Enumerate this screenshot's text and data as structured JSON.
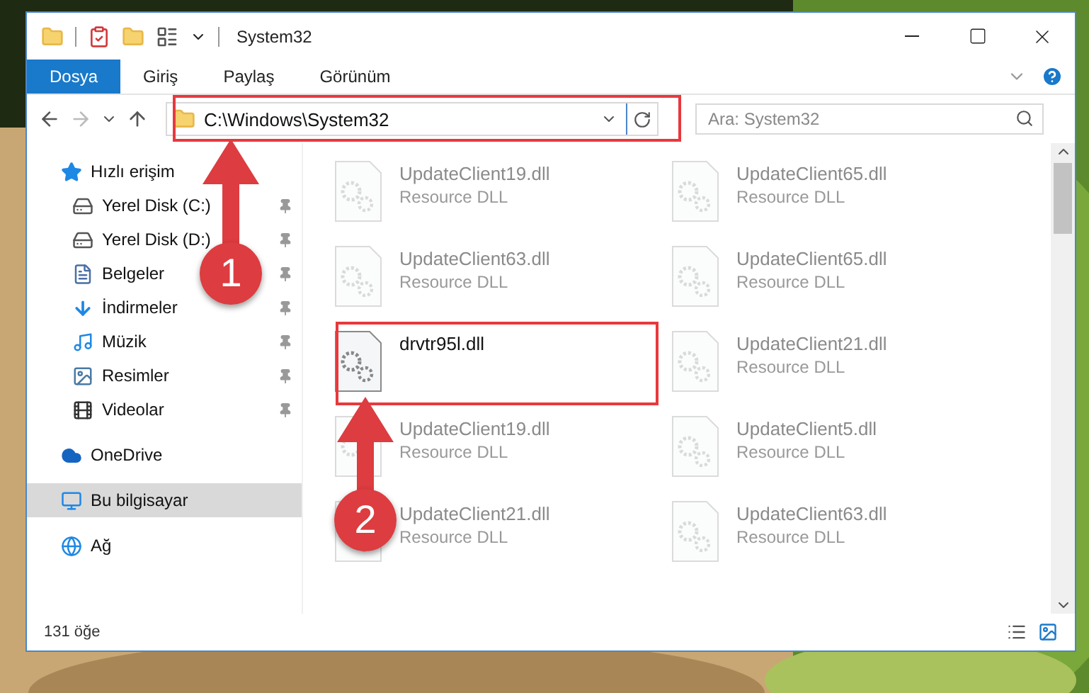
{
  "window": {
    "title": "System32"
  },
  "ribbon": {
    "tabs": [
      {
        "label": "Dosya",
        "selected": true
      },
      {
        "label": "Giriş",
        "selected": false
      },
      {
        "label": "Paylaş",
        "selected": false
      },
      {
        "label": "Görünüm",
        "selected": false
      }
    ]
  },
  "address": {
    "path": "C:\\Windows\\System32"
  },
  "search": {
    "placeholder": "Ara: System32"
  },
  "sidebar": {
    "items": [
      {
        "label": "Hızlı erişim",
        "kind": "quick-access",
        "selected": false,
        "children": [
          {
            "label": "Yerel Disk (C:)",
            "kind": "system-drive",
            "selected": false,
            "pinned": true
          },
          {
            "label": "Yerel Disk (D:)",
            "kind": "drive",
            "selected": false,
            "pinned": true
          },
          {
            "label": "Belgeler",
            "kind": "documents",
            "selected": false,
            "pinned": true
          },
          {
            "label": "İndirmeler",
            "kind": "downloads",
            "selected": false,
            "pinned": true
          },
          {
            "label": "Müzik",
            "kind": "music",
            "selected": false,
            "pinned": true
          },
          {
            "label": "Resimler",
            "kind": "pictures",
            "selected": false,
            "pinned": true
          },
          {
            "label": "Videolar",
            "kind": "videos",
            "selected": false,
            "pinned": true
          }
        ]
      },
      {
        "label": "OneDrive",
        "kind": "cloud",
        "selected": false
      },
      {
        "label": "Bu bilgisayar",
        "kind": "computer",
        "selected": true
      },
      {
        "label": "Ağ",
        "kind": "network",
        "selected": false
      }
    ]
  },
  "files": [
    {
      "name": "UpdateClient19.dll",
      "type": "Resource DLL",
      "faded": true
    },
    {
      "name": "UpdateClient65.dll",
      "type": "Resource DLL",
      "faded": true
    },
    {
      "name": "UpdateClient63.dll",
      "type": "Resource DLL",
      "faded": true
    },
    {
      "name": "UpdateClient65.dll",
      "type": "Resource DLL",
      "faded": true
    },
    {
      "name": "drvtr95l.dll",
      "faded": false
    },
    {
      "name": "UpdateClient21.dll",
      "type": "Resource DLL",
      "faded": true
    },
    {
      "name": "UpdateClient19.dll",
      "type": "Resource DLL",
      "faded": true
    },
    {
      "name": "UpdateClient5.dll",
      "type": "Resource DLL",
      "faded": true
    },
    {
      "name": "UpdateClient21.dll",
      "type": "Resource DLL",
      "faded": true
    },
    {
      "name": "UpdateClient63.dll",
      "type": "Resource DLL",
      "faded": true
    }
  ],
  "status_bar": {
    "item_count": "131 öğe"
  },
  "annotations": [
    {
      "number": "1"
    },
    {
      "number": "2"
    }
  ]
}
